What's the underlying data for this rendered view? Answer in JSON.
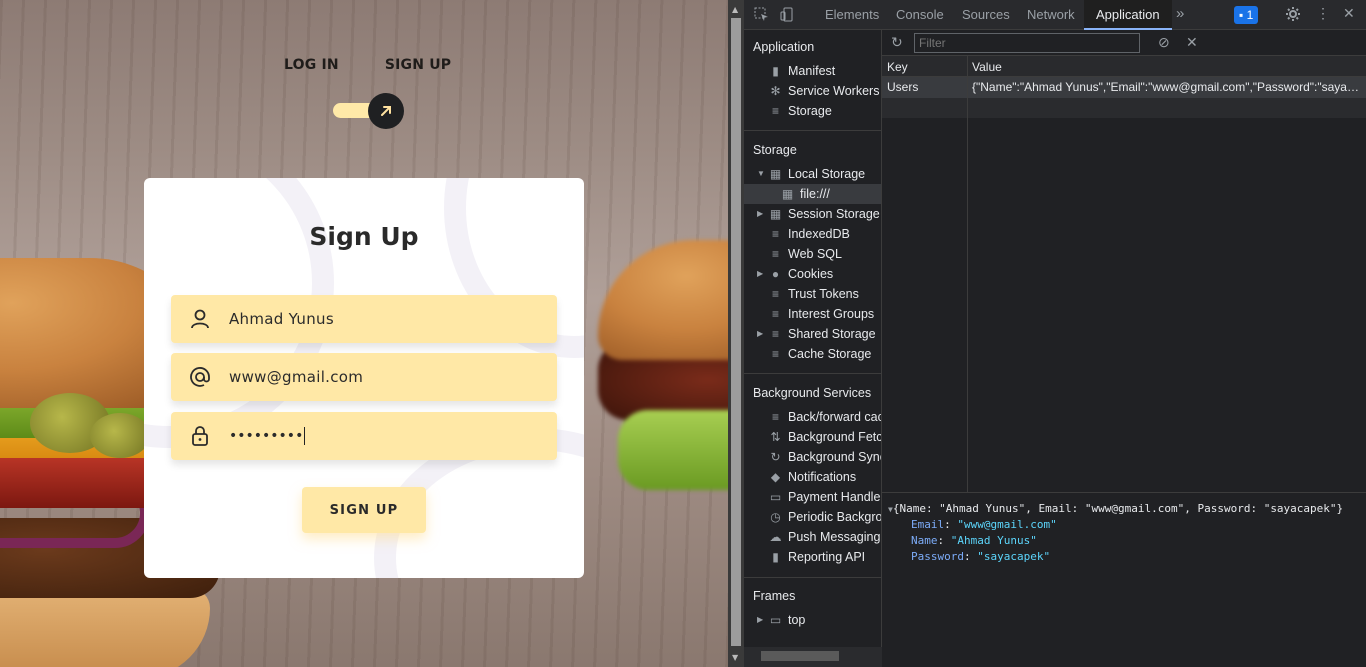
{
  "webpage": {
    "tabs": {
      "login": "LOG IN",
      "signup": "SIGN UP"
    },
    "toggle_icon": "arrow-up-right-icon",
    "form": {
      "title": "Sign Up",
      "name_value": "Ahmad Yunus",
      "email_value": "www@gmail.com",
      "password_value": "•••••••••",
      "submit_label": "SIGN UP"
    },
    "colors": {
      "accent": "#ffe8a6",
      "dark": "#1f2022"
    }
  },
  "devtools": {
    "tabs": [
      "Elements",
      "Console",
      "Sources",
      "Network",
      "Application"
    ],
    "active_tab": "Application",
    "issues_count": "1",
    "sidebar": {
      "application_heading": "Application",
      "application_items": [
        "Manifest",
        "Service Workers",
        "Storage"
      ],
      "storage_heading": "Storage",
      "storage_items": [
        "Local Storage",
        "file:///",
        "Session Storage",
        "IndexedDB",
        "Web SQL",
        "Cookies",
        "Trust Tokens",
        "Interest Groups",
        "Shared Storage",
        "Cache Storage"
      ],
      "background_heading": "Background Services",
      "background_items": [
        "Back/forward cache",
        "Background Fetch",
        "Background Sync",
        "Notifications",
        "Payment Handler",
        "Periodic Background Sync",
        "Push Messaging",
        "Reporting API"
      ],
      "frames_heading": "Frames",
      "frames_items": [
        "top"
      ]
    },
    "filter_placeholder": "Filter",
    "grid": {
      "headers": {
        "key": "Key",
        "value": "Value"
      },
      "rows": [
        {
          "key": "Users",
          "value": "{\"Name\":\"Ahmad Yunus\",\"Email\":\"www@gmail.com\",\"Password\":\"sayacapek\"}"
        }
      ]
    },
    "preview": {
      "summary": "{Name: \"Ahmad Yunus\", Email: \"www@gmail.com\", Password: \"sayacapek\"}",
      "props": [
        {
          "key": "Email",
          "value": "\"www@gmail.com\""
        },
        {
          "key": "Name",
          "value": "\"Ahmad Yunus\""
        },
        {
          "key": "Password",
          "value": "\"sayacapek\""
        }
      ]
    }
  }
}
